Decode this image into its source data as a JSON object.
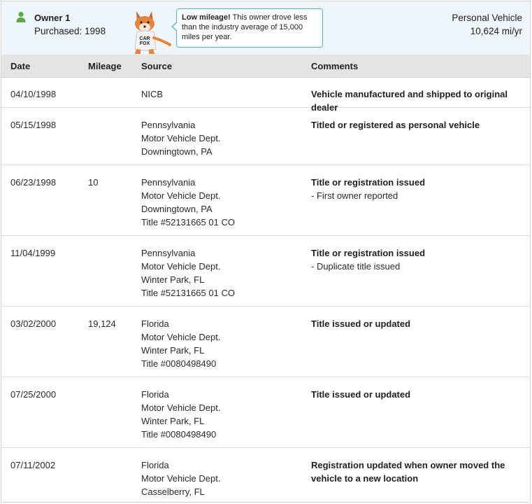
{
  "owner": {
    "icon": "person-icon",
    "name": "Owner 1",
    "purchased": "Purchased: 1998",
    "vehicle_type": "Personal Vehicle",
    "miles_per_year": "10,624 mi/yr",
    "bubble_bold": "Low mileage!",
    "bubble_text": " This owner drove less than the industry average of 15,000 miles per year.",
    "mascot_text_1": "CAR",
    "mascot_text_2": "FOX"
  },
  "table": {
    "headers": [
      "Date",
      "Mileage",
      "Source",
      "Comments"
    ],
    "rows": [
      {
        "date": "04/10/1998",
        "mileage": "",
        "source": [
          "NICB"
        ],
        "comment_title": "Vehicle manufactured and shipped to original dealer",
        "comment_sub": []
      },
      {
        "date": "05/15/1998",
        "mileage": "",
        "source": [
          "Pennsylvania",
          "Motor Vehicle Dept.",
          "Downingtown, PA"
        ],
        "comment_title": "Titled or registered as personal vehicle",
        "comment_sub": []
      },
      {
        "date": "06/23/1998",
        "mileage": "10",
        "source": [
          "Pennsylvania",
          "Motor Vehicle Dept.",
          "Downingtown, PA",
          "Title #52131665 01 CO"
        ],
        "comment_title": "Title or registration issued",
        "comment_sub": [
          "- First owner reported"
        ]
      },
      {
        "date": "11/04/1999",
        "mileage": "",
        "source": [
          "Pennsylvania",
          "Motor Vehicle Dept.",
          "Winter Park, FL",
          "Title #52131665 01 CO"
        ],
        "comment_title": "Title or registration issued",
        "comment_sub": [
          "- Duplicate title issued"
        ]
      },
      {
        "date": "03/02/2000",
        "mileage": "19,124",
        "source": [
          "Florida",
          "Motor Vehicle Dept.",
          "Winter Park, FL",
          "Title #0080498490"
        ],
        "comment_title": "Title issued or updated",
        "comment_sub": []
      },
      {
        "date": "07/25/2000",
        "mileage": "",
        "source": [
          "Florida",
          "Motor Vehicle Dept.",
          "Winter Park, FL",
          "Title #0080498490"
        ],
        "comment_title": "Title issued or updated",
        "comment_sub": []
      },
      {
        "date": "07/11/2002",
        "mileage": "",
        "source": [
          "Florida",
          "Motor Vehicle Dept.",
          "Casselberry, FL"
        ],
        "comment_title": "Registration updated when owner moved the vehicle to a new location",
        "comment_sub": []
      }
    ]
  },
  "colors": {
    "header_bg": "#eef5fb",
    "table_header_bg": "#e4e4e4",
    "owner_icon": "#5aa845",
    "bubble_border": "#59b8b6",
    "mascot_orange": "#e8843a"
  }
}
